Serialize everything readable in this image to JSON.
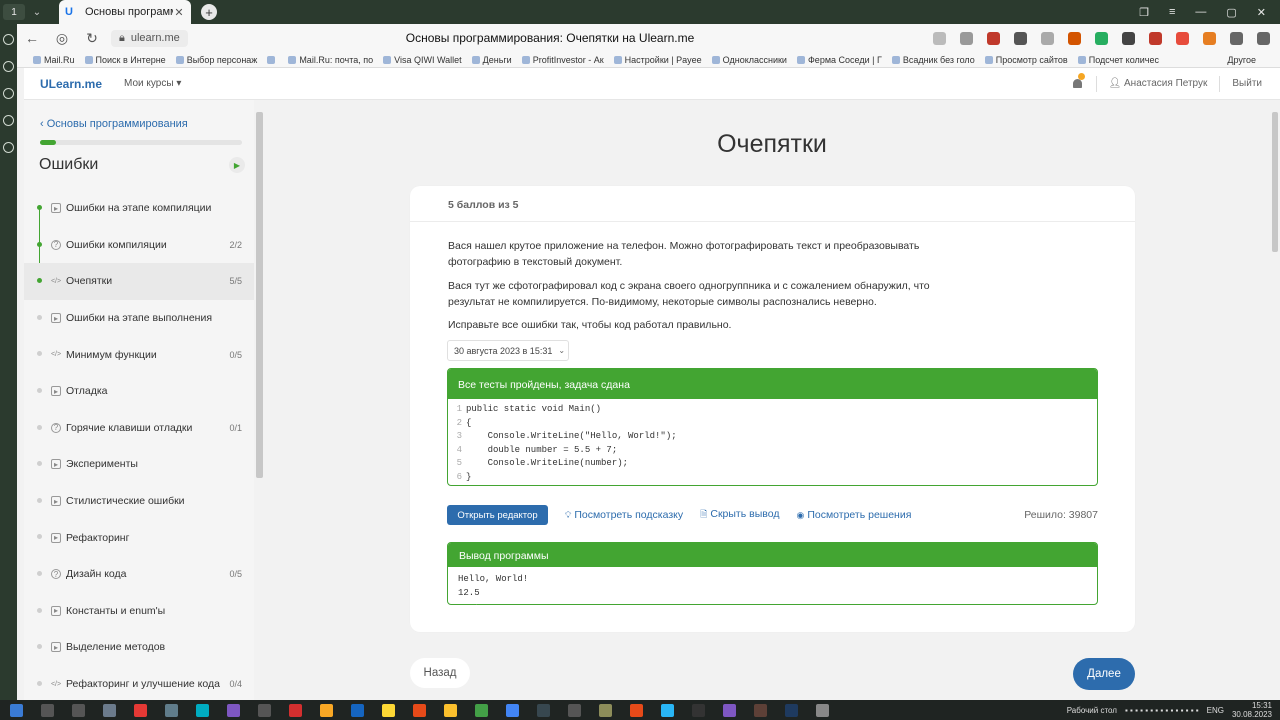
{
  "browser": {
    "workspace": "1",
    "tab_title": "Основы программиро",
    "url": "ulearn.me",
    "page_title": "Основы программирования: Очепятки на Ulearn.me",
    "bookmarks": [
      "Mail.Ru",
      "Поиск в Интерне",
      "Выбор персонаж",
      "",
      "Mail.Ru: почта, по",
      "Visa QIWI Wallet",
      "Деньги",
      "ProfitInvestor - Ак",
      "Настройки | Payee",
      "Одноклассники",
      "Ферма Соседи | Г",
      "Всадник без голо",
      "Просмотр сайтов",
      "Подсчет количес"
    ],
    "bookmarks_more": "Другое"
  },
  "header": {
    "logo": "ULearn.me",
    "my_courses": "Мои курсы",
    "user": "Анастасия Петрук",
    "logout": "Выйти"
  },
  "sidebar": {
    "back_link": "Основы программирования",
    "progress": 0.08,
    "unit_title": "Ошибки",
    "items": [
      {
        "label": "Ошибки на этапе компиляции",
        "type": "video",
        "score": "",
        "done": true
      },
      {
        "label": "Ошибки компиляции",
        "type": "quiz",
        "score": "2/2",
        "done": true
      },
      {
        "label": "Очепятки",
        "type": "code",
        "score": "5/5",
        "done": true
      },
      {
        "label": "Ошибки на этапе выполнения",
        "type": "video",
        "score": "",
        "done": false
      },
      {
        "label": "Минимум функции",
        "type": "code",
        "score": "0/5",
        "done": false
      },
      {
        "label": "Отладка",
        "type": "video",
        "score": "",
        "done": false
      },
      {
        "label": "Горячие клавиши отладки",
        "type": "quiz",
        "score": "0/1",
        "done": false
      },
      {
        "label": "Эксперименты",
        "type": "video",
        "score": "",
        "done": false
      },
      {
        "label": "Стилистические ошибки",
        "type": "video",
        "score": "",
        "done": false
      },
      {
        "label": "Рефакторинг",
        "type": "video",
        "score": "",
        "done": false
      },
      {
        "label": "Дизайн кода",
        "type": "quiz",
        "score": "0/5",
        "done": false
      },
      {
        "label": "Константы и enum'ы",
        "type": "video",
        "score": "",
        "done": false
      },
      {
        "label": "Выделение методов",
        "type": "video",
        "score": "",
        "done": false
      },
      {
        "label": "Рефакторинг и улучшение кода",
        "type": "code",
        "score": "0/4",
        "done": false
      }
    ]
  },
  "main": {
    "title": "Очепятки",
    "score": "5 баллов из 5",
    "paragraphs": [
      "Вася нашел крутое приложение на телефон. Можно фотографировать текст и преобразовывать фотографию в текстовый документ.",
      "Вася тут же сфотографировал код с экрана своего одногруппника и с сожалением обнаружил, что результат не компилируется. По-видимому, некоторые символы распознались неверно.",
      "Исправьте все ошибки так, чтобы код работал правильно."
    ],
    "submission_date": "30 августа 2023 в 15:31",
    "status": "Все тесты пройдены, задача сдана",
    "code": [
      "public static void Main()",
      "{",
      "    Console.WriteLine(\"Hello, World!\");",
      "    double number = 5.5 + 7;",
      "    Console.WriteLine(number);",
      "}"
    ],
    "open_editor": "Открыть редактор",
    "hint": "Посмотреть подсказку",
    "hide_output": "Скрыть вывод",
    "solutions": "Посмотреть решения",
    "solved": "Решило: 39807",
    "output_title": "Вывод программы",
    "output_lines": [
      "Hello, World!",
      "12.5"
    ],
    "back": "Назад",
    "next": "Далее"
  },
  "taskbar": {
    "desktop": "Рабочий стол",
    "lang": "ENG",
    "time": "15:31",
    "date": "30.08.2023"
  },
  "colors": {
    "accent": "#2d6cad",
    "success": "#43a532"
  }
}
